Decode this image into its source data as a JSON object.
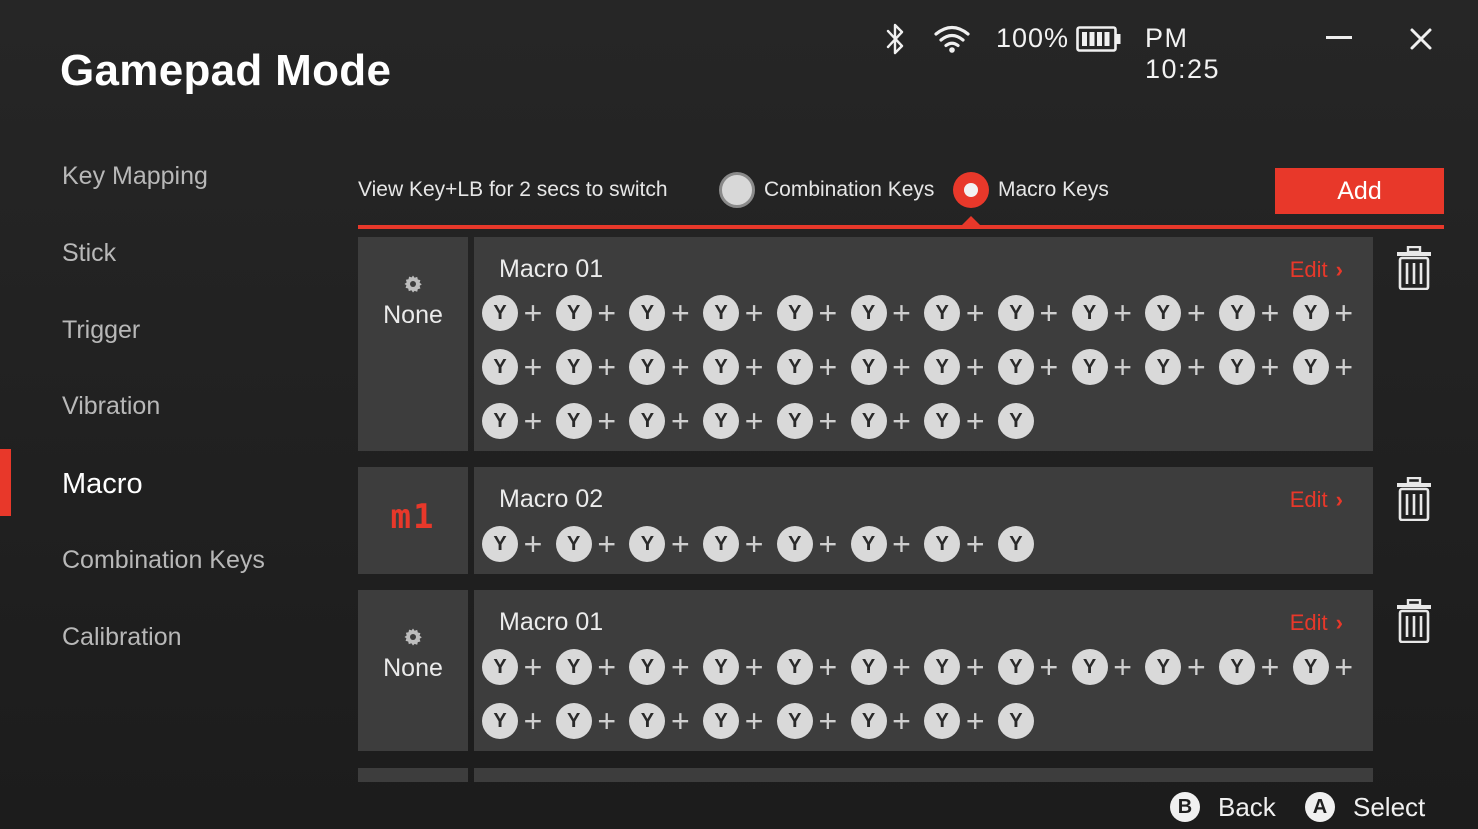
{
  "app": {
    "title": "Gamepad Mode"
  },
  "status": {
    "battery": "100%",
    "time": "PM 10:25"
  },
  "sidebar": {
    "items": [
      {
        "label": "Key Mapping"
      },
      {
        "label": "Stick"
      },
      {
        "label": "Trigger"
      },
      {
        "label": "Vibration"
      },
      {
        "label": "Macro",
        "active": true
      },
      {
        "label": "Combination Keys"
      },
      {
        "label": "Calibration"
      }
    ]
  },
  "toolbar": {
    "hint": "View Key+LB for 2 secs  to switch",
    "options": [
      {
        "label": "Combination Keys",
        "selected": false
      },
      {
        "label": "Macro Keys",
        "selected": true
      }
    ],
    "add_label": "Add"
  },
  "macros": [
    {
      "key": "None",
      "name": "Macro 01",
      "edit": "Edit",
      "sequence_lines": [
        12,
        12,
        8
      ]
    },
    {
      "key": "m1",
      "name": "Macro 02",
      "edit": "Edit",
      "sequence_lines": [
        8
      ]
    },
    {
      "key": "None",
      "name": "Macro 01",
      "edit": "Edit",
      "sequence_lines": [
        12,
        8
      ]
    }
  ],
  "sequence_button": "Y",
  "footer": {
    "back_glyph": "B",
    "back_label": "Back",
    "select_glyph": "A",
    "select_label": "Select"
  },
  "colors": {
    "accent": "#e8382a",
    "panel": "#3d3d3d",
    "background": "#1f1f1f"
  }
}
